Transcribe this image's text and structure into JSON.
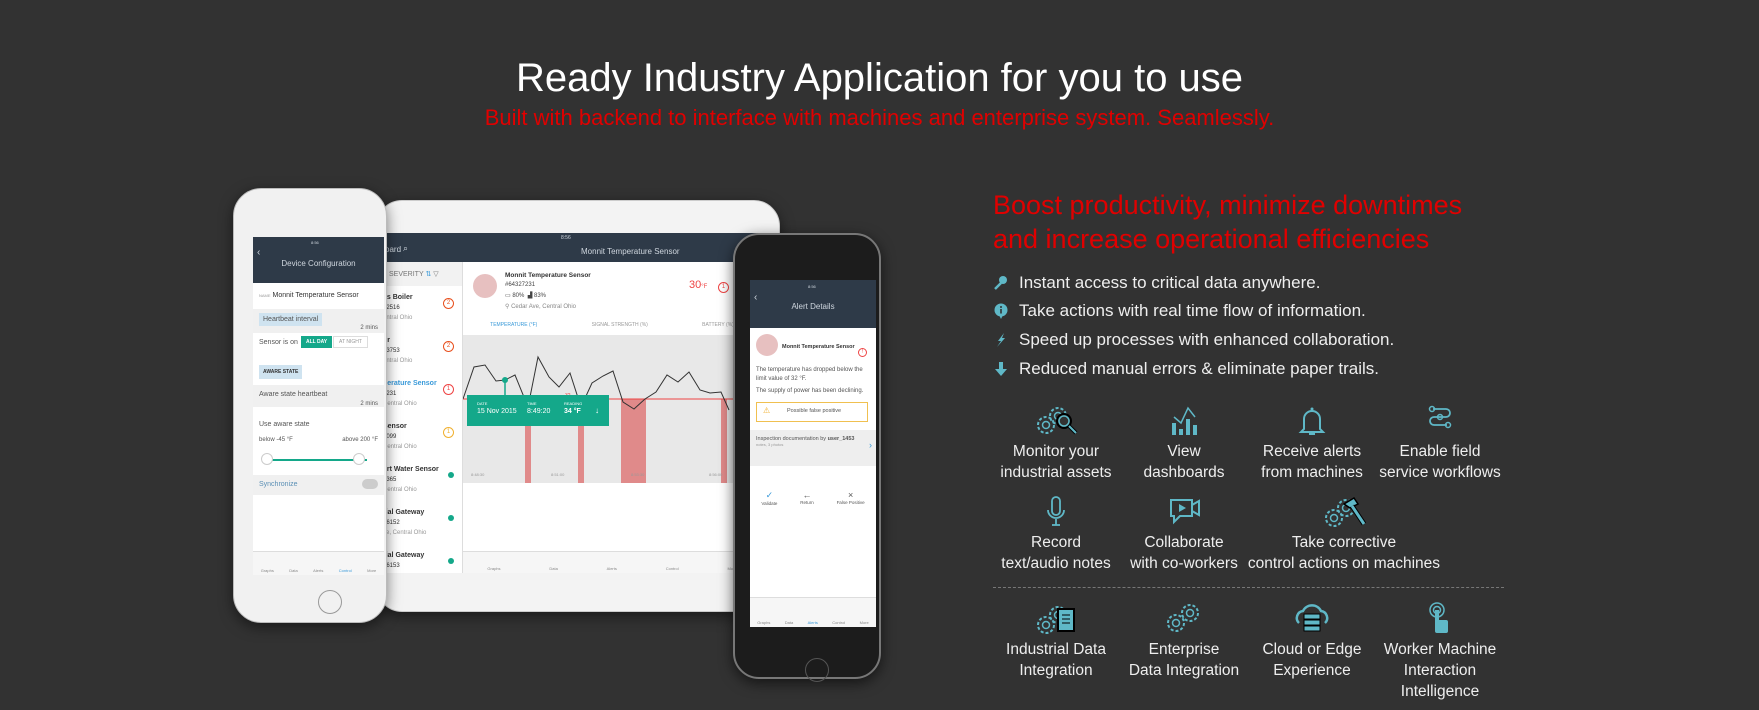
{
  "header": {
    "title": "Ready Industry Application for you to use",
    "subtitle": "Built with backend to interface with machines and enterprise system. Seamlessly."
  },
  "tablet": {
    "status_time": "8:56",
    "back_label": "oard",
    "title": "Monnit Temperature Sensor",
    "sort_label": "SEVERITY",
    "list": [
      {
        "name": "ks Boiler",
        "id": "12516",
        "loc": "entral Ohio",
        "badge": "2",
        "color": "#e8501e"
      },
      {
        "name": "or",
        "id": "33753",
        "loc": "entral Ohio",
        "badge": "2",
        "color": "#e8501e"
      },
      {
        "name": "perature Sensor",
        "id": "7231",
        "loc": "Central Ohio",
        "badge": "1",
        "color": "#e44"
      },
      {
        "name": "Sensor",
        "id": "5099",
        "loc": "Central Ohio",
        "badge": "1",
        "color": "#f0b030"
      },
      {
        "name": "art Water Sensor",
        "id": "3365",
        "loc": "Central Ohio",
        "badge": "",
        "color": "#14a88a"
      },
      {
        "name": "rial Gateway",
        "id": "26152",
        "loc": "se, Central Ohio",
        "badge": "",
        "color": "#14a88a"
      },
      {
        "name": "rial Gateway",
        "id": "26153",
        "loc": "",
        "badge": "",
        "color": "#14a88a"
      }
    ],
    "sensor": {
      "name": "Monnit Temperature Sensor",
      "id": "#64327231",
      "battery": "80%",
      "signal": "83%",
      "location": "Cedar Ave, Central Ohio",
      "reading": "30",
      "unit": "°F",
      "alert_count": "1"
    },
    "tabs": [
      "TEMPERATURE (°F)",
      "SIGNAL STRENGTH (%)",
      "BATTERY (%)"
    ],
    "threshold_label": "32",
    "x_ticks": [
      "8:48:30",
      "8:51:00",
      "8:53:30",
      "8:56:00"
    ],
    "tooltip": {
      "date_label": "DATE",
      "date": "15 Nov 2015",
      "time_label": "TIME",
      "time": "8:49:20",
      "reading_label": "READING",
      "reading": "34 °F"
    },
    "nav": [
      "Graphs",
      "Data",
      "Alerts",
      "Control",
      "More"
    ]
  },
  "phone_left": {
    "time": "8:56",
    "title": "Device Configuration",
    "name_label": "NAME",
    "name": "Monnit Temperature Sensor",
    "heartbeat_label": "Heartbeat interval",
    "heartbeat_value": "2 mins",
    "sensor_on_label": "Sensor is on",
    "toggle": [
      "ALL DAY",
      "AT NIGHT"
    ],
    "aware_state": "AWARE STATE",
    "aware_heartbeat": "Aware state heartbeat",
    "aware_value": "2 mins",
    "use_aware": "Use aware state",
    "below": "below",
    "below_value": "-45 °F",
    "above": "above",
    "above_value": "200 °F",
    "synchronize": "Synchronize",
    "nav": [
      "Graphs",
      "Data",
      "Alerts",
      "Control",
      "More"
    ]
  },
  "phone_right": {
    "time": "8:56",
    "title": "Alert Details",
    "sensor": "Monnit Temperature Sensor",
    "message1": "The temperature has dropped below the limit value of 32 °F.",
    "message2": "The supply of power has been declining.",
    "warning": "Possible false positive",
    "inspection": "Inspection documentation by",
    "user": "user_1453",
    "notes": "notes, 3 photos",
    "actions": [
      "Validate",
      "Return",
      "False Positive"
    ],
    "nav": [
      "Graphs",
      "Data",
      "Alerts",
      "Control",
      "More"
    ]
  },
  "benefits": {
    "heading_line1": "Boost productivity, minimize downtimes",
    "heading_line2": "and increase operational efficiencies",
    "bullets": [
      {
        "icon": "key-icon",
        "text": "Instant access to critical data anywhere."
      },
      {
        "icon": "info-pin-icon",
        "text": "Take actions with real time flow of information."
      },
      {
        "icon": "lightning-icon",
        "text": "Speed up processes with enhanced collaboration."
      },
      {
        "icon": "arrow-down-icon",
        "text": "Reduced manual errors & eliminate paper trails."
      }
    ],
    "features": [
      {
        "icon": "gears-magnifier-icon",
        "line1": "Monitor your",
        "line2": "industrial assets"
      },
      {
        "icon": "dashboard-chart-icon",
        "line1": "View",
        "line2": "dashboards"
      },
      {
        "icon": "bell-icon",
        "line1": "Receive alerts",
        "line2": "from machines"
      },
      {
        "icon": "workflow-icon",
        "line1": "Enable field",
        "line2": "service workflows"
      },
      {
        "icon": "microphone-icon",
        "line1": "Record",
        "line2": "text/audio notes"
      },
      {
        "icon": "video-chat-icon",
        "line1": "Collaborate",
        "line2": "with co-workers"
      },
      {
        "icon": "gears-hammer-icon",
        "line1": "Take corrective",
        "line2": "control actions on machines"
      }
    ],
    "integrations": [
      {
        "icon": "gears-document-icon",
        "line1": "Industrial Data",
        "line2": "Integration",
        "line3": ""
      },
      {
        "icon": "gears-icon",
        "line1": "Enterprise",
        "line2": "Data Integration",
        "line3": ""
      },
      {
        "icon": "cloud-server-icon",
        "line1": "Cloud or Edge",
        "line2": "Experience",
        "line3": ""
      },
      {
        "icon": "touch-hand-icon",
        "line1": "Worker Machine",
        "line2": "Interaction",
        "line3": "Intelligence"
      }
    ]
  },
  "colors": {
    "accent_red": "#e00000",
    "icon_teal": "#5fb8c7",
    "background": "#323232",
    "chart_green": "#14a88a"
  }
}
